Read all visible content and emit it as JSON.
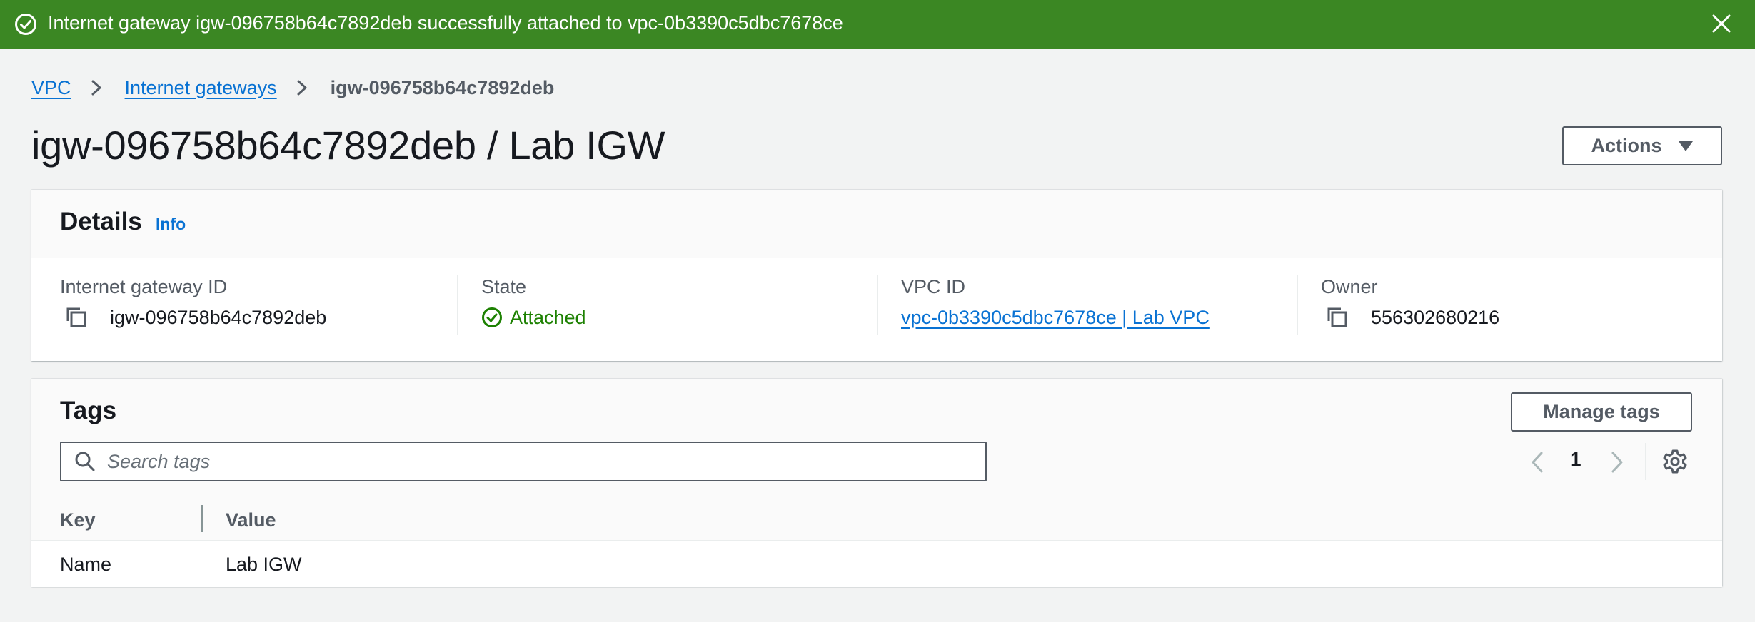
{
  "flash": {
    "message": "Internet gateway igw-096758b64c7892deb successfully attached to vpc-0b3390c5dbc7678ce",
    "color": "#3b8723"
  },
  "breadcrumb": {
    "items": [
      "VPC",
      "Internet gateways"
    ],
    "current": "igw-096758b64c7892deb"
  },
  "page": {
    "title": "igw-096758b64c7892deb / Lab IGW",
    "actions_label": "Actions"
  },
  "details": {
    "heading": "Details",
    "info_label": "Info",
    "fields": [
      {
        "label": "Internet gateway ID",
        "value": "igw-096758b64c7892deb"
      },
      {
        "label": "State",
        "value": "Attached"
      },
      {
        "label": "VPC ID",
        "value": "vpc-0b3390c5dbc7678ce | Lab VPC"
      },
      {
        "label": "Owner",
        "value": "556302680216"
      }
    ]
  },
  "tags": {
    "heading": "Tags",
    "manage_label": "Manage tags",
    "search_placeholder": "Search tags",
    "page_number": "1",
    "columns": [
      "Key",
      "Value"
    ],
    "rows": [
      {
        "key": "Name",
        "value": "Lab IGW"
      }
    ]
  },
  "colors": {
    "link": "#0972d3",
    "success": "#1d8102",
    "flash_bg": "#3b8723"
  }
}
